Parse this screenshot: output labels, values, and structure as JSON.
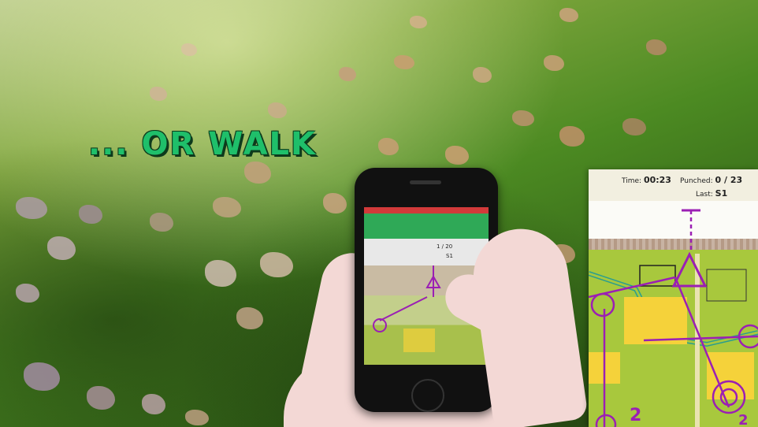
{
  "overlay": {
    "caption": "... OR WALK"
  },
  "inset": {
    "time_label": "Time:",
    "time_value": "00:23",
    "punched_label": "Punched:",
    "punched_value": "0 / 23",
    "last_label": "Last:",
    "last_value": "S1",
    "map_numbers": [
      "2",
      "2"
    ]
  },
  "phone": {
    "punched_value": "1 / 20",
    "last_value": "S1"
  },
  "colors": {
    "caption_green": "#1fbf6a",
    "course_purple": "#9b1fb4",
    "map_green": "#a8c83d",
    "map_yellow": "#f5d23a"
  }
}
